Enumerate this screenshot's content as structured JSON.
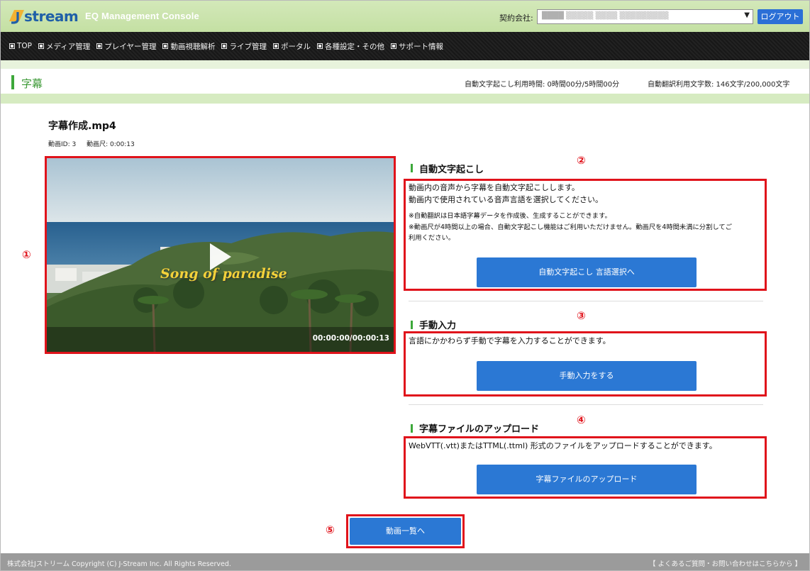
{
  "header": {
    "logo_text": "stream",
    "console_title": "EQ Management Console",
    "company_label": "契約会社:",
    "company_value": "████ ▒▒▒▒▒ ▒▒▒▒ ▒▒▒▒▒▒▒▒▒",
    "logout_label": "ログアウト",
    "accent_color": "#2b6fd6"
  },
  "nav": {
    "items": [
      {
        "label": "TOP"
      },
      {
        "label": "メディア管理"
      },
      {
        "label": "プレイヤー管理"
      },
      {
        "label": "動画視聴解析"
      },
      {
        "label": "ライブ管理"
      },
      {
        "label": "ポータル"
      },
      {
        "label": "各種設定・その他"
      },
      {
        "label": "サポート情報"
      }
    ]
  },
  "page": {
    "title": "字幕",
    "usage_transcription": "自動文字起こし利用時間: 0時間00分/5時間00分",
    "usage_translation": "自動翻訳利用文字数: 146文字/200,000文字"
  },
  "video": {
    "title": "字幕作成.mp4",
    "meta_id": "動画ID: 3",
    "meta_duration": "動画尺: 0:00:13",
    "overlay_text": "Song of paradise",
    "time_display": "00:00:00/00:00:13"
  },
  "annotations": {
    "a1": "①",
    "a2": "②",
    "a3": "③",
    "a4": "④",
    "a5": "⑤",
    "color": "#e0131b"
  },
  "sections": {
    "auto": {
      "title": "自動文字起こし",
      "desc1": "動画内の音声から字幕を自動文字起こしします。",
      "desc2": "動画内で使用されている音声言語を選択してください。",
      "note1": "※自動翻訳は日本語字幕データを作成後、生成することができます。",
      "note2": "※動画尺が4時間以上の場合、自動文字起こし機能はご利用いただけません。動画尺を4時間未満に分割してご",
      "note3": "利用ください。",
      "button": "自動文字起こし 言語選択へ"
    },
    "manual": {
      "title": "手動入力",
      "desc": "言語にかかわらず手動で字幕を入力することができます。",
      "button": "手動入力をする"
    },
    "upload": {
      "title": "字幕ファイルのアップロード",
      "desc": "WebVTT(.vtt)またはTTML(.ttml) 形式のファイルをアップロードすることができます。",
      "button": "字幕ファイルのアップロード"
    }
  },
  "back_button": "動画一覧へ",
  "footer": {
    "copyright": "株式会社Jストリーム Copyright (C) J-Stream Inc. All Rights Reserved.",
    "help_link": "【 よくあるご質問・お問い合わせはこちらから 】"
  }
}
